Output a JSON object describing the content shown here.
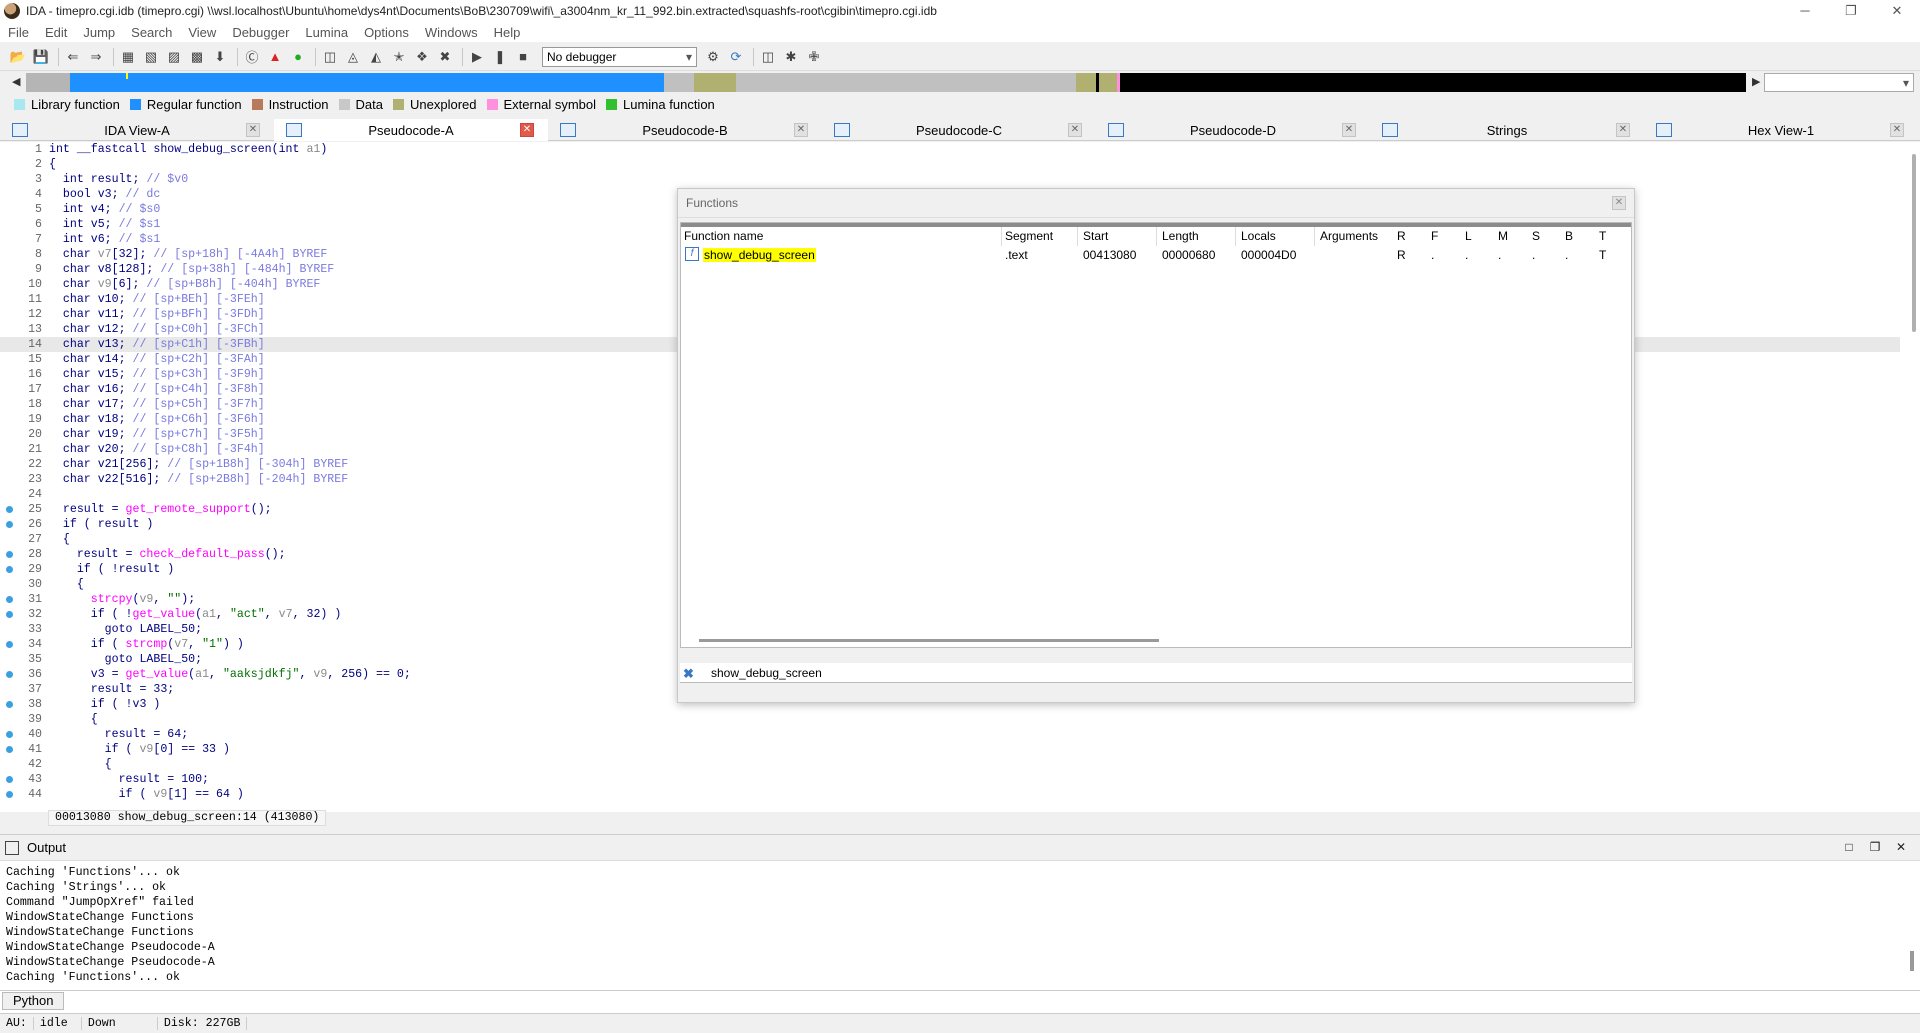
{
  "window": {
    "title": "IDA - timepro.cgi.idb (timepro.cgi) \\\\wsl.localhost\\Ubuntu\\home\\dys4nt\\Documents\\BoB\\230709\\wifi\\_a3004nm_kr_11_992.bin.extracted\\squashfs-root\\cgibin\\timepro.cgi.idb",
    "minimize": "─",
    "restore": "❐",
    "close": "✕"
  },
  "menu": [
    "File",
    "Edit",
    "Jump",
    "Search",
    "View",
    "Debugger",
    "Lumina",
    "Options",
    "Windows",
    "Help"
  ],
  "toolbar": {
    "debugger_select": "No debugger",
    "icons_left": [
      "open-icon",
      "save-icon",
      "back-icon",
      "forward-icon",
      "binary-icon",
      "code-icon",
      "data-icon",
      "unknown-icon",
      "down-arrow-icon",
      "text-icon",
      "ida-icon",
      "green-circle-icon",
      "graph-icon",
      "structure-icon",
      "enum-icon",
      "xref-icon",
      "patch-icon",
      "cross-icon"
    ],
    "icons_right": [
      "play-icon",
      "pause-icon",
      "stop-icon",
      "debug-icon",
      "attach-icon",
      "breakpoint-icon",
      "trace-icon",
      "tools-icon"
    ]
  },
  "legend": [
    {
      "label": "Library function",
      "color": "#a8e8f0"
    },
    {
      "label": "Regular function",
      "color": "#1e90ff"
    },
    {
      "label": "Instruction",
      "color": "#b87a5a"
    },
    {
      "label": "Data",
      "color": "#c8c8c8"
    },
    {
      "label": "Unexplored",
      "color": "#b0b070"
    },
    {
      "label": "External symbol",
      "color": "#ff90e0"
    },
    {
      "label": "Lumina function",
      "color": "#30c030"
    }
  ],
  "tabs": [
    {
      "label": "IDA View-A",
      "active": false
    },
    {
      "label": "Pseudocode-A",
      "active": true
    },
    {
      "label": "Pseudocode-B",
      "active": false
    },
    {
      "label": "Pseudocode-C",
      "active": false
    },
    {
      "label": "Pseudocode-D",
      "active": false
    },
    {
      "label": "Strings",
      "active": false
    },
    {
      "label": "Hex View-1",
      "active": false
    }
  ],
  "code": {
    "lines": [
      {
        "n": "1",
        "t": "int __fastcall show_debug_screen(int a1)"
      },
      {
        "n": "2",
        "t": "{"
      },
      {
        "n": "3",
        "t": "  int result; // $v0"
      },
      {
        "n": "4",
        "t": "  bool v3; // dc"
      },
      {
        "n": "5",
        "t": "  int v4; // $s0"
      },
      {
        "n": "6",
        "t": "  int v5; // $s1"
      },
      {
        "n": "7",
        "t": "  int v6; // $s1"
      },
      {
        "n": "8",
        "t": "  char v7[32]; // [sp+18h] [-4A4h] BYREF"
      },
      {
        "n": "9",
        "t": "  char v8[128]; // [sp+38h] [-484h] BYREF"
      },
      {
        "n": "10",
        "t": "  char v9[6]; // [sp+B8h] [-404h] BYREF"
      },
      {
        "n": "11",
        "t": "  char v10; // [sp+BEh] [-3FEh]"
      },
      {
        "n": "12",
        "t": "  char v11; // [sp+BFh] [-3FDh]"
      },
      {
        "n": "13",
        "t": "  char v12; // [sp+C0h] [-3FCh]"
      },
      {
        "n": "14",
        "t": "  char v13; // [sp+C1h] [-3FBh]"
      },
      {
        "n": "15",
        "t": "  char v14; // [sp+C2h] [-3FAh]"
      },
      {
        "n": "16",
        "t": "  char v15; // [sp+C3h] [-3F9h]"
      },
      {
        "n": "17",
        "t": "  char v16; // [sp+C4h] [-3F8h]"
      },
      {
        "n": "18",
        "t": "  char v17; // [sp+C5h] [-3F7h]"
      },
      {
        "n": "19",
        "t": "  char v18; // [sp+C6h] [-3F6h]"
      },
      {
        "n": "20",
        "t": "  char v19; // [sp+C7h] [-3F5h]"
      },
      {
        "n": "21",
        "t": "  char v20; // [sp+C8h] [-3F4h]"
      },
      {
        "n": "22",
        "t": "  char v21[256]; // [sp+1B8h] [-304h] BYREF"
      },
      {
        "n": "23",
        "t": "  char v22[516]; // [sp+2B8h] [-204h] BYREF"
      },
      {
        "n": "24",
        "t": ""
      },
      {
        "n": "25",
        "t": "  result = get_remote_support();"
      },
      {
        "n": "26",
        "t": "  if ( result )"
      },
      {
        "n": "27",
        "t": "  {"
      },
      {
        "n": "28",
        "t": "    result = check_default_pass();"
      },
      {
        "n": "29",
        "t": "    if ( !result )"
      },
      {
        "n": "30",
        "t": "    {"
      },
      {
        "n": "31",
        "t": "      strcpy(v9, \"\");"
      },
      {
        "n": "32",
        "t": "      if ( !get_value(a1, \"act\", v7, 32) )"
      },
      {
        "n": "33",
        "t": "        goto LABEL_50;"
      },
      {
        "n": "34",
        "t": "      if ( strcmp(v7, \"1\") )"
      },
      {
        "n": "35",
        "t": "        goto LABEL_50;"
      },
      {
        "n": "36",
        "t": "      v3 = get_value(a1, \"aaksjdkfj\", v9, 256) == 0;"
      },
      {
        "n": "37",
        "t": "      result = 33;"
      },
      {
        "n": "38",
        "t": "      if ( !v3 )"
      },
      {
        "n": "39",
        "t": "      {"
      },
      {
        "n": "40",
        "t": "        result = 64;"
      },
      {
        "n": "41",
        "t": "        if ( v9[0] == 33 )"
      },
      {
        "n": "42",
        "t": "        {"
      },
      {
        "n": "43",
        "t": "          result = 100;"
      },
      {
        "n": "44",
        "t": "          if ( v9[1] == 64 )"
      }
    ],
    "status": "00013080 show_debug_screen:14 (413080)"
  },
  "functions_window": {
    "title": "Functions",
    "columns": [
      "Function name",
      "Segment",
      "Start",
      "Length",
      "Locals",
      "Arguments",
      "R",
      "F",
      "L",
      "M",
      "S",
      "B",
      "T"
    ],
    "rows": [
      {
        "name": "show_debug_screen",
        "segment": ".text",
        "start": "00413080",
        "length": "00000680",
        "locals": "000004D0",
        "arguments": "",
        "R": "R",
        "F": ".",
        "L": ".",
        "M": ".",
        "S": ".",
        "B": ".",
        "T": "T"
      }
    ],
    "filter": "show_debug_screen"
  },
  "output": {
    "title": "Output",
    "lines": [
      "Caching 'Functions'... ok",
      "Caching 'Strings'... ok",
      "Command \"JumpOpXref\" failed",
      "WindowStateChange Functions",
      "WindowStateChange Functions",
      "WindowStateChange Pseudocode-A",
      "WindowStateChange Pseudocode-A",
      "Caching 'Functions'... ok"
    ],
    "lang_button": "Python"
  },
  "statusbar": {
    "au": "AU:",
    "state": "idle",
    "direction": "Down",
    "disk": "Disk: 227GB"
  }
}
